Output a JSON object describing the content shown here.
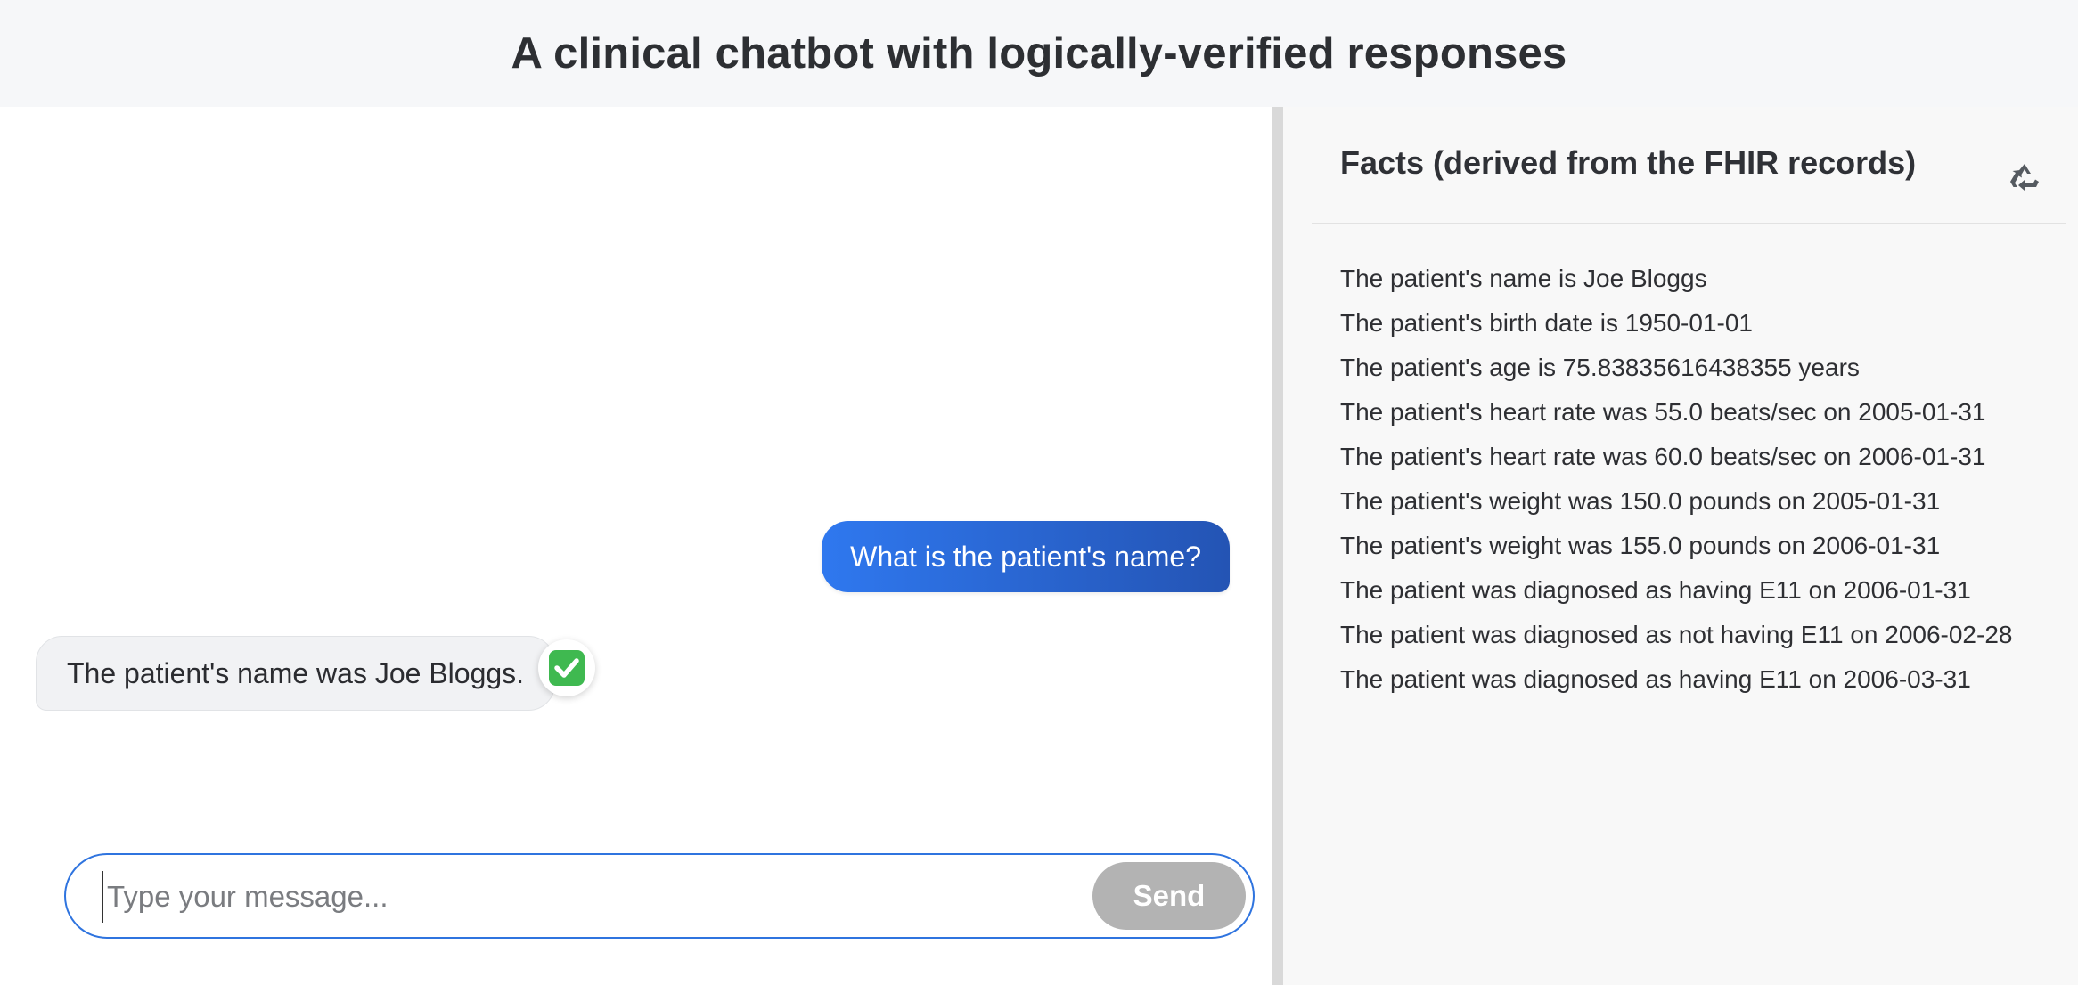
{
  "header": {
    "title": "A clinical chatbot with logically-verified responses"
  },
  "chat": {
    "messages": [
      {
        "role": "user",
        "text": "What is the patient's name?"
      },
      {
        "role": "bot",
        "text": "The patient's name was Joe Bloggs.",
        "verified": true,
        "badge_icon": "check-mark-icon"
      }
    ],
    "input": {
      "placeholder": "Type your message...",
      "value": ""
    },
    "send_label": "Send",
    "colors": {
      "user_bubble_start": "#2f78ef",
      "user_bubble_end": "#2454b4",
      "send_disabled": "#b3b3b3",
      "input_border": "#2f74df",
      "verified_green": "#3fb950"
    }
  },
  "facts": {
    "title": "Facts (derived from the FHIR records)",
    "refresh_icon": "recycle-icon",
    "items": [
      "The patient's name is Joe Bloggs",
      "The patient's birth date is 1950-01-01",
      "The patient's age is 75.83835616438355 years",
      "The patient's heart rate was 55.0 beats/sec on 2005-01-31",
      "The patient's heart rate was 60.0 beats/sec on 2006-01-31",
      "The patient's weight was 150.0 pounds on 2005-01-31",
      "The patient's weight was 155.0 pounds on 2006-01-31",
      "The patient was diagnosed as having E11 on 2006-01-31",
      "The patient was diagnosed as not having E11 on 2006-02-28",
      "The patient was diagnosed as having E11 on 2006-03-31"
    ]
  }
}
